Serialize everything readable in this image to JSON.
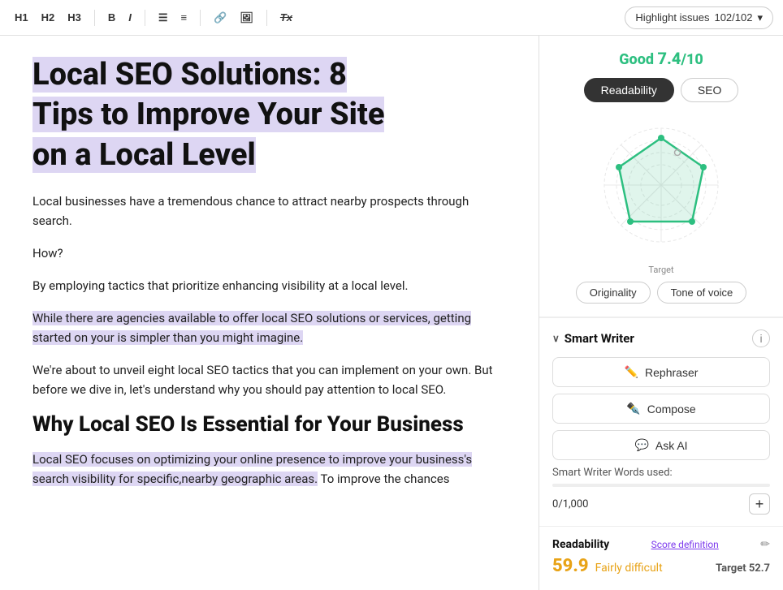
{
  "toolbar": {
    "h1_label": "H1",
    "h2_label": "H2",
    "h3_label": "H3",
    "bold_label": "B",
    "italic_label": "I",
    "highlight_issues_label": "Highlight issues",
    "highlight_count": "102/102"
  },
  "editor": {
    "title": "Local SEO Solutions: 8 Tips to Improve Your Site on a Local Level",
    "title_line1": "Local SEO Solutions: 8",
    "title_line2": "Tips to Improve Your Site",
    "title_line3": "on a Local Level",
    "para1": "Local businesses have a tremendous chance to attract nearby prospects through search.",
    "para2": "How?",
    "para3": "By employing tactics that prioritize enhancing visibility at a local level.",
    "para4_highlighted": "While there are agencies available to offer local SEO solutions or services, getting started on your is simpler than you might imagine.",
    "para5": "We're about to unveil eight local SEO tactics that you can implement on your own. But before we dive in, let's understand why you should pay attention to local SEO.",
    "section_heading": "Why Local SEO Is Essential for Your Business",
    "para6_highlighted": "Local SEO focuses on optimizing your online presence to improve your business's search visibility for specific,nearby geographic areas.",
    "para6_rest": " To improve the chances"
  },
  "sidebar": {
    "score_prefix": "Good ",
    "score_value": "7.4",
    "score_suffix": "/10",
    "tab_readability": "Readability",
    "tab_seo": "SEO",
    "radar_target": "Target",
    "pill_originality": "Originality",
    "pill_tone_of_voice": "Tone of voice",
    "smart_writer_title": "Smart Writer",
    "smart_writer_info": "i",
    "btn_rephraser": "Rephraser",
    "btn_compose": "Compose",
    "btn_ask_ai": "Ask AI",
    "words_used_label": "Smart Writer Words used:",
    "words_current": "0",
    "words_total": "1,000",
    "words_add": "+",
    "readability_title": "Readability",
    "score_def": "Score definition",
    "readability_score": "59.9",
    "readability_difficulty": "Fairly difficult",
    "readability_target_label": "Target",
    "readability_target_value": "52.7"
  }
}
